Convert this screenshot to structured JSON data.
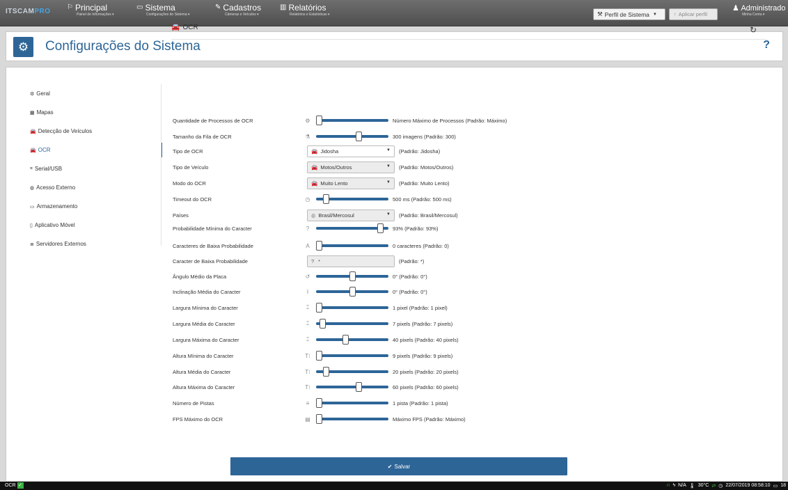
{
  "nav": {
    "logo_a": "ITSCAM",
    "logo_b": "PRO",
    "items": [
      {
        "icon": "flag-icon",
        "glyph": "⚐",
        "label": "Principal",
        "sub": "Painel de Informações ▾"
      },
      {
        "icon": "monitor-icon",
        "glyph": "🖵",
        "label": "Sistema",
        "sub": "Configurações do Sistema ▾"
      },
      {
        "icon": "edit-icon",
        "glyph": "✎",
        "label": "Cadastros",
        "sub": "Câmeras e Veículos ▾"
      },
      {
        "icon": "bar-chart-icon",
        "glyph": "▥",
        "label": "Relatórios",
        "sub": "Relatórios e Estatísticas ▾"
      }
    ],
    "perfil": "Perfil de Sistema",
    "aplicar": "Aplicar perfil",
    "admin": "Administrado",
    "admin_sub": "Minha Conta ▾"
  },
  "header": {
    "title": "Configurações do Sistema",
    "help": "?"
  },
  "sidebar": {
    "items": [
      {
        "icon": "gears-icon",
        "glyph": "⚙",
        "label": "Geral"
      },
      {
        "icon": "map-icon",
        "glyph": "▦",
        "label": "Mapas"
      },
      {
        "icon": "car-icon",
        "glyph": "🚘",
        "label": "Detecção de Veículos"
      },
      {
        "icon": "car-icon",
        "glyph": "🚘",
        "label": "OCR"
      },
      {
        "icon": "plug-icon",
        "glyph": "⌗",
        "label": "Serial/USB"
      },
      {
        "icon": "globe-icon",
        "glyph": "◍",
        "label": "Acesso Externo"
      },
      {
        "icon": "hdd-icon",
        "glyph": "▭",
        "label": "Armazenamento"
      },
      {
        "icon": "mobile-icon",
        "glyph": "▯",
        "label": "Aplicativo Móvel"
      },
      {
        "icon": "servers-icon",
        "glyph": "≣",
        "label": "Servidores Externos"
      }
    ]
  },
  "section": {
    "title": "OCR"
  },
  "settings": [
    {
      "label": "Quantidade de Processos de OCR",
      "icon": "gears-icon",
      "glyph": "⚙",
      "type": "slider",
      "level": 0.0,
      "value": "Número Máximo de Processos  (Padrão: Máximo)"
    },
    {
      "label": "Tamanho da Fila de OCR",
      "icon": "queue-icon",
      "glyph": "⚗",
      "type": "slider",
      "level": 0.6,
      "value": "300 imagens  (Padrão: 300)"
    },
    {
      "label": "Tipo de OCR",
      "icon": "car-icon",
      "type": "select",
      "gray": false,
      "option": "Jidosha",
      "value": "(Padrão: Jidosha)"
    },
    {
      "label": "Tipo de Veículo",
      "icon": "car-icon",
      "type": "select",
      "gray": true,
      "option": "Motos/Outros",
      "value": "(Padrão: Motos/Outros)"
    },
    {
      "label": "Modo do OCR",
      "icon": "car-icon",
      "type": "select",
      "gray": true,
      "option": "Muito Lento",
      "value": "(Padrão: Muito Lento)"
    },
    {
      "label": "Timeout do OCR",
      "icon": "clock-icon",
      "glyph": "◷",
      "type": "slider",
      "level": 0.1,
      "value": "500 ms  (Padrão: 500 ms)"
    },
    {
      "label": "Países",
      "icon": "globe-icon",
      "type": "select",
      "gray": true,
      "option": "Brasil/Mercosul",
      "value": "(Padrão: Brasil/Mercosul)"
    },
    {
      "label": "Probabilidade Mínima do Caracter",
      "icon": "question-icon",
      "glyph": "?",
      "type": "slider",
      "level": 0.93,
      "value": "93%  (Padrão: 93%)"
    },
    {
      "label": "Caracteres de Baixa Probabilidade",
      "icon": "font-icon",
      "glyph": "A",
      "type": "slider",
      "level": 0.0,
      "value": "0 caracteres  (Padrão: 0)"
    },
    {
      "label": "Caracter de Baixa Probabilidade",
      "icon": "question-icon",
      "type": "text",
      "text": "*",
      "value": "(Padrão: *)"
    },
    {
      "label": "Ângulo Médio da Placa",
      "icon": "rotate-icon",
      "glyph": "↺",
      "type": "slider",
      "level": 0.5,
      "value": "0°  (Padrão: 0°)"
    },
    {
      "label": "Inclinação Média do Caracter",
      "icon": "italic-icon",
      "glyph": "I",
      "type": "slider",
      "level": 0.5,
      "value": "0°  (Padrão: 0°)"
    },
    {
      "label": "Largura Mínima do Caracter",
      "icon": "text-width-icon",
      "glyph": "⌶",
      "type": "slider",
      "level": 0.0,
      "value": "1 pixel  (Padrão: 1 pixel)"
    },
    {
      "label": "Largura Média do Caracter",
      "icon": "text-width-icon",
      "glyph": "⌶",
      "type": "slider",
      "level": 0.05,
      "value": "7 pixels  (Padrão: 7 pixels)"
    },
    {
      "label": "Largura Máxima do Caracter",
      "icon": "text-width-icon",
      "glyph": "⌶",
      "type": "slider",
      "level": 0.4,
      "value": "40 pixels  (Padrão: 40 pixels)"
    },
    {
      "label": "Altura Mínima do Caracter",
      "icon": "text-height-icon",
      "glyph": "T⁝",
      "type": "slider",
      "level": 0.0,
      "value": "9 pixels  (Padrão: 9 pixels)"
    },
    {
      "label": "Altura Média do Caracter",
      "icon": "text-height-icon",
      "glyph": "T⁝",
      "type": "slider",
      "level": 0.1,
      "value": "20 pixels  (Padrão: 20 pixels)"
    },
    {
      "label": "Altura Máxima do Caracter",
      "icon": "text-height-icon",
      "glyph": "T⁝",
      "type": "slider",
      "level": 0.6,
      "value": "60 pixels  (Padrão: 60 pixels)"
    },
    {
      "label": "Número de Pistas",
      "icon": "lanes-icon",
      "glyph": "≡",
      "type": "slider",
      "level": 0.0,
      "value": "1 pista  (Padrão: 1 pista)"
    },
    {
      "label": "FPS Máximo do OCR",
      "icon": "film-icon",
      "glyph": "▤",
      "type": "slider",
      "level": 0.0,
      "value": "Máximo FPS  (Padrão: Máximo)"
    }
  ],
  "save": "Salvar",
  "status": {
    "left": "OCR",
    "na": "N/A",
    "temp": "30°C",
    "datetime": "22/07/2019 08:58:10",
    "tail": "18"
  },
  "colors": {
    "accent": "#2d6597",
    "ok": "#3cb043"
  }
}
